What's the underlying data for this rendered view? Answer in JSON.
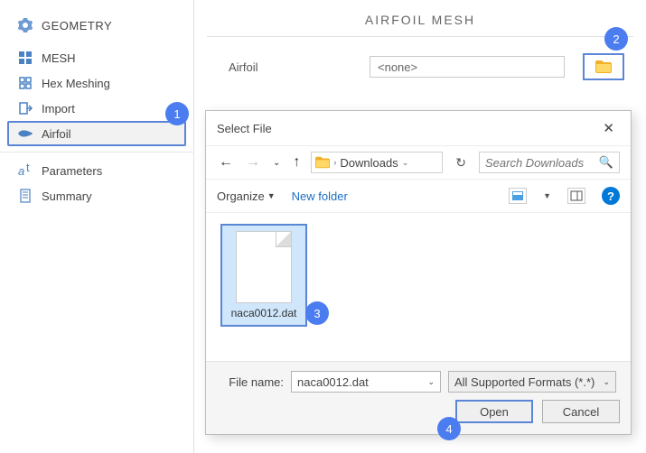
{
  "sidebar": {
    "section": "GEOMETRY",
    "items": [
      {
        "label": "MESH"
      },
      {
        "label": "Hex Meshing"
      },
      {
        "label": "Import"
      },
      {
        "label": "Airfoil"
      }
    ],
    "lower": [
      {
        "label": "Parameters"
      },
      {
        "label": "Summary"
      }
    ]
  },
  "main": {
    "title": "AIRFOIL MESH",
    "field_label": "Airfoil",
    "field_value": "<none>"
  },
  "dialog": {
    "title": "Select File",
    "path": "Downloads",
    "search_placeholder": "Search Downloads",
    "organize": "Organize",
    "new_folder": "New folder",
    "file": "naca0012.dat",
    "file_name_label": "File name:",
    "file_name_value": "naca0012.dat",
    "filter": "All Supported Formats (*.*)",
    "open": "Open",
    "cancel": "Cancel"
  },
  "badges": {
    "b1": "1",
    "b2": "2",
    "b3": "3",
    "b4": "4"
  }
}
